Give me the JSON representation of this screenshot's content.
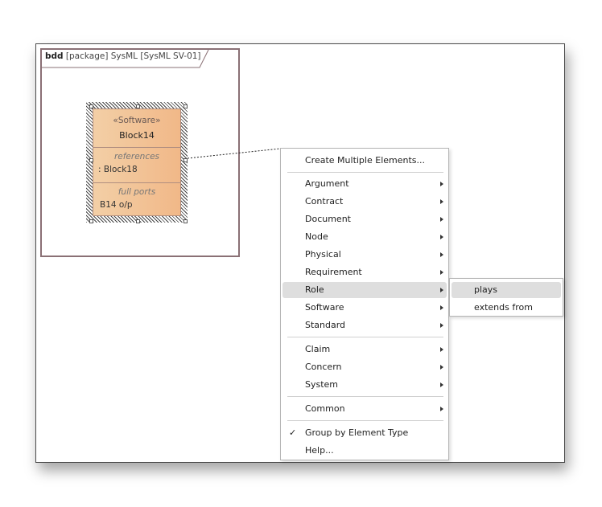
{
  "diagram": {
    "frame_kind": "bdd",
    "frame_label": "[package] SysML [SysML SV-01]",
    "block": {
      "stereotype": "«Software»",
      "name": "Block14",
      "compartments": [
        {
          "title": "references",
          "item": ": Block18"
        },
        {
          "title": "full ports",
          "item": "B14 o/p"
        }
      ]
    }
  },
  "context_menu": {
    "create_multiple": "Create Multiple Elements...",
    "groups": [
      [
        "Argument",
        "Contract",
        "Document",
        "Node",
        "Physical",
        "Requirement",
        "Role",
        "Software",
        "Standard"
      ],
      [
        "Claim",
        "Concern",
        "System"
      ],
      [
        "Common"
      ]
    ],
    "highlighted": "Role",
    "group_by": "Group by Element Type",
    "group_by_checked": true,
    "help": "Help..."
  },
  "submenu": {
    "items": [
      "plays",
      "extends from"
    ],
    "highlighted": "plays"
  },
  "colors": {
    "block_fill_start": "#f3cfa6",
    "block_fill_end": "#f1b888",
    "frame_border": "#8a7075",
    "highlight": "#dedede"
  }
}
